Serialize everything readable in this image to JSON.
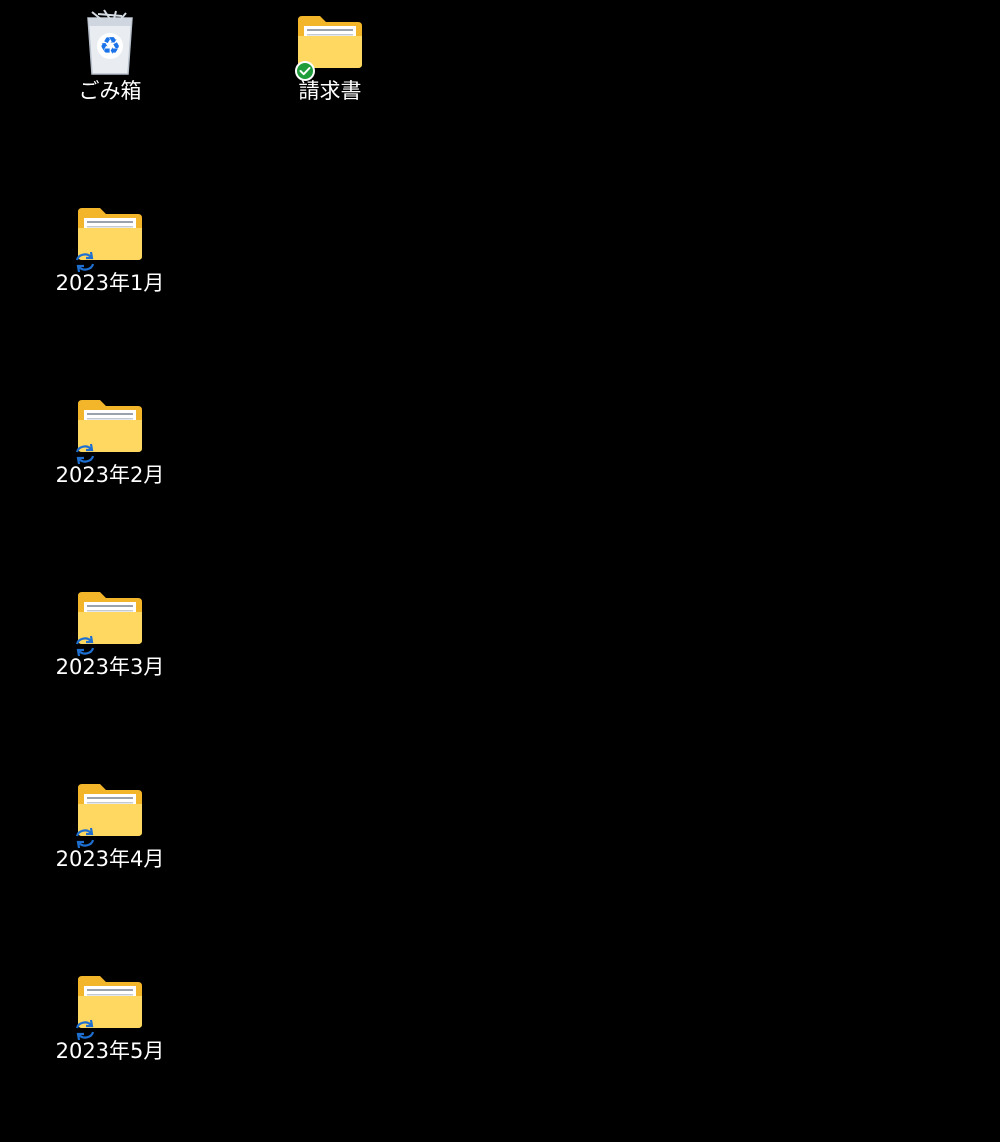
{
  "desktop": {
    "background": "#000000",
    "icons": [
      {
        "label": "ごみ箱",
        "type": "recycle-bin"
      },
      {
        "label": "請求書",
        "type": "folder",
        "status": "synced"
      },
      {
        "label": "2023年1月",
        "type": "folder",
        "status": "syncing"
      },
      {
        "label": "2023年2月",
        "type": "folder",
        "status": "syncing"
      },
      {
        "label": "2023年3月",
        "type": "folder",
        "status": "syncing"
      },
      {
        "label": "2023年4月",
        "type": "folder",
        "status": "syncing"
      },
      {
        "label": "2023年5月",
        "type": "folder",
        "status": "syncing"
      }
    ]
  },
  "colors": {
    "folder_front": "#ffd862",
    "folder_back": "#f3b52a",
    "synced_badge": "#1f9d3a",
    "sync_icon": "#1e6fd0",
    "recycle_symbol": "#1a73e8"
  }
}
